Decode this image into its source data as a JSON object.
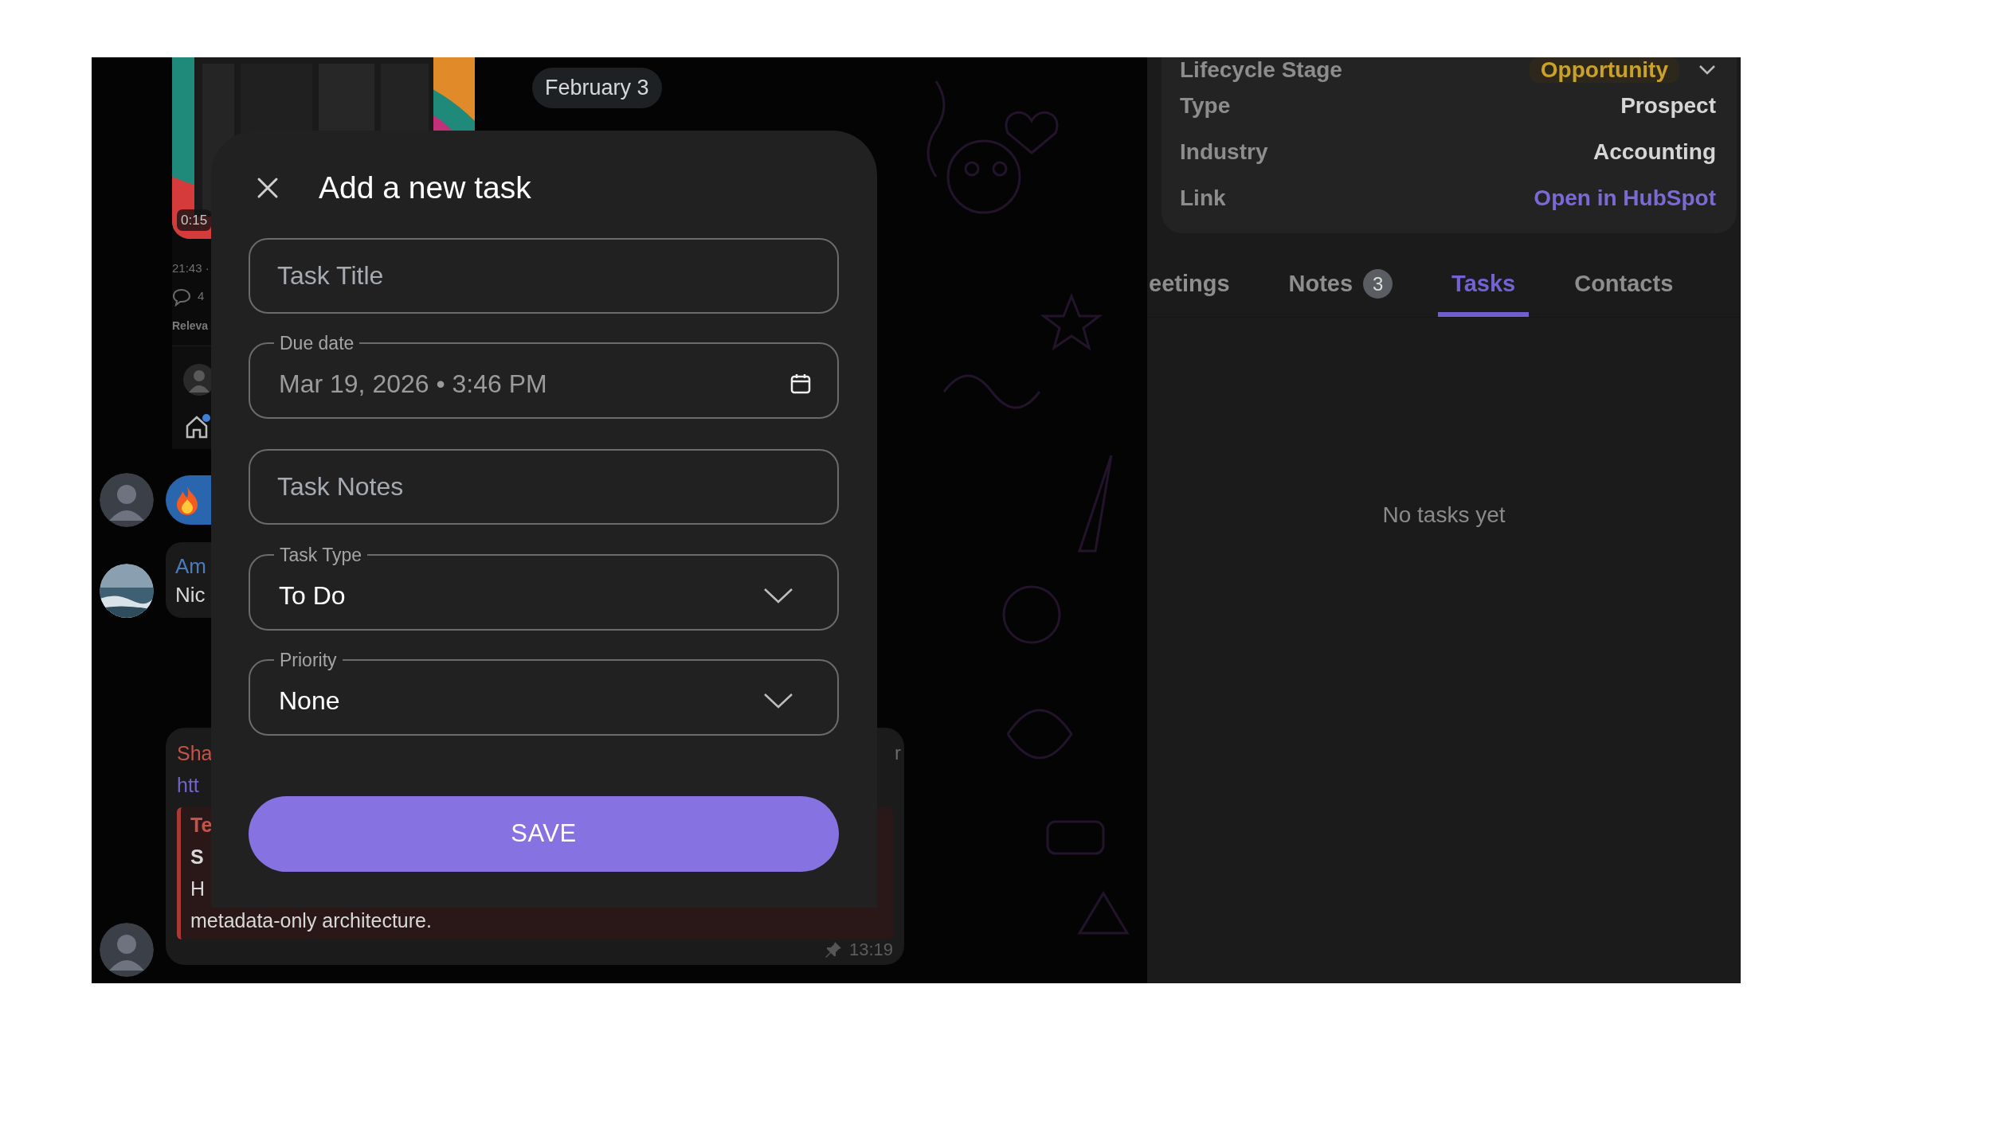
{
  "chat": {
    "date_chip": "February 3",
    "video": {
      "kind": "picture",
      "duration": "0:15"
    },
    "post_meta": {
      "time": "21:43 ·",
      "comments": "4",
      "section": "Releva"
    },
    "messages": [
      {
        "kind": "reaction"
      },
      {
        "kind": "text",
        "sender": "Am",
        "lines": [
          "Nic"
        ]
      },
      {
        "kind": "quote",
        "sender": "Sha",
        "side_text": "r",
        "link": "htt",
        "quote": {
          "title": "Te",
          "lines": [
            "S",
            "H",
            "metadata-only architecture."
          ]
        },
        "time": "13:19",
        "pinned": true
      }
    ]
  },
  "crm": {
    "fields": [
      {
        "kind": "badge",
        "label": "Lifecycle Stage",
        "value": "Opportunity"
      },
      {
        "kind": "text",
        "label": "Type",
        "value": "Prospect"
      },
      {
        "kind": "text",
        "label": "Industry",
        "value": "Accounting"
      },
      {
        "kind": "link",
        "label": "Link",
        "value": "Open in HubSpot"
      }
    ],
    "tabs": [
      {
        "label": "eetings",
        "selected": false
      },
      {
        "label": "Notes",
        "count": "3",
        "selected": false
      },
      {
        "label": "Tasks",
        "selected": true
      },
      {
        "label": "Contacts",
        "selected": false
      }
    ],
    "empty_message": "No tasks yet"
  },
  "dialog": {
    "title": "Add a new task",
    "fields": [
      {
        "kind": "text",
        "placeholder": "Task Title"
      },
      {
        "kind": "date",
        "label": "Due date",
        "value": "Mar 19, 2026 • 3:46 PM"
      },
      {
        "kind": "text",
        "placeholder": "Task Notes"
      },
      {
        "kind": "select",
        "label": "Task Type",
        "value": "To Do"
      },
      {
        "kind": "select",
        "label": "Priority",
        "value": "None"
      }
    ],
    "save": "SAVE"
  }
}
